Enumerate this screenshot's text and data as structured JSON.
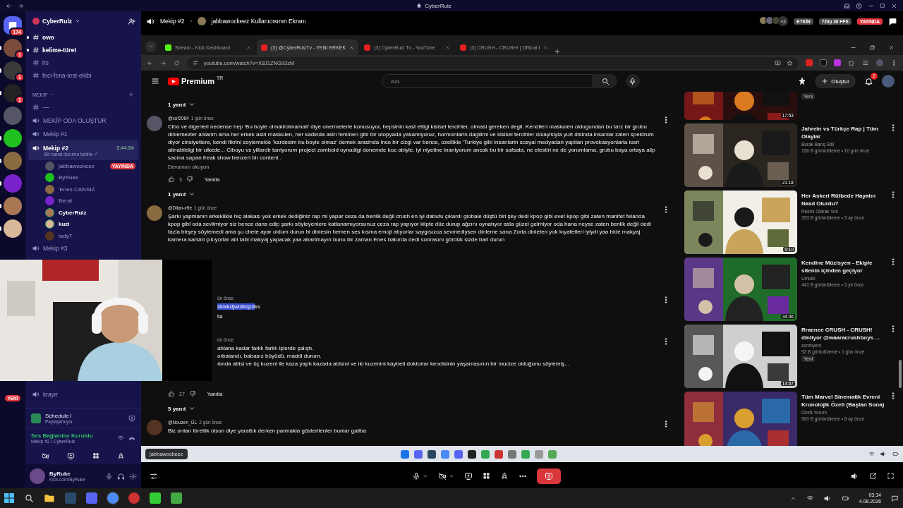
{
  "title_bar": {
    "title": "CyberRulz"
  },
  "server_rail": {
    "home_badge": "174",
    "new_badge": "YENİ",
    "servers": [
      {
        "unread": true,
        "badge": "1"
      },
      {
        "unread": true,
        "badge": "1"
      },
      {
        "unread": true,
        "badge": "1"
      },
      {
        "unread": false
      },
      {
        "unread": true
      },
      {
        "unread": true
      },
      {
        "unread": true
      },
      {
        "unread": true
      },
      {
        "unread": true
      }
    ]
  },
  "sidebar": {
    "server_name": "CyberRulz",
    "category": "MEKİP",
    "channels": [
      {
        "name": "owo",
        "unread": true
      },
      {
        "name": "kelime-türet",
        "unread": true
      },
      {
        "name": "lrs",
        "unread": false
      },
      {
        "name": "feci-fena-test-ekibi",
        "unread": false
      }
    ],
    "items": [
      {
        "kind": "text",
        "name": "—",
        "selected": false
      },
      {
        "kind": "voice",
        "name": "MEKİP ODA OLUŞTUR",
        "selected": false
      },
      {
        "kind": "voice",
        "name": "Mekip #1",
        "selected": false
      },
      {
        "kind": "voice",
        "name": "Mekip #2",
        "selected": true,
        "timer": "3:44:54",
        "status": "Bir kanal durumu belirle",
        "members": [
          {
            "name": "jabbawockeez",
            "speaking": false,
            "live": "YAYINDA"
          },
          {
            "name": "ByRuke",
            "speaking": false
          },
          {
            "name": "'Enes CANSIZ",
            "speaking": false
          },
          {
            "name": "Berat",
            "speaking": false
          },
          {
            "name": "CyberRulz",
            "speaking": true
          },
          {
            "name": "kuzi",
            "speaking": true
          },
          {
            "name": "ladyT",
            "speaking": false
          }
        ]
      },
      {
        "kind": "voice",
        "name": "Mekip #3",
        "selected": false
      }
    ],
    "lower_items": [
      {
        "kind": "voice",
        "name": "krayir",
        "selected": false
      }
    ],
    "activity": {
      "title": "Schedule I",
      "subtitle": "Paylaşılmıyor"
    },
    "voice_panel": {
      "status": "Ses Bağlantısı Kuruldu",
      "location": "Mekip #2 / CyberRulz"
    },
    "user_panel": {
      "name": "ByRuke",
      "status": "Kick.com/ByRuke"
    }
  },
  "stream_header": {
    "channel": "Mekip #2",
    "title": "jabbawockeez Kullanıcısının Ekranı",
    "viewer_extra": "+2",
    "activity_badge": "ETKİN",
    "quality": "720p 30 FPS",
    "live_badge": "YAYINDA"
  },
  "browser": {
    "url": "youtube.com/watch?v=X8J1ZNG93zM",
    "tabs": [
      {
        "title": "Stream - Kick Dashboard",
        "kind": "kick",
        "selected": false
      },
      {
        "title": "(3) @CyberRulzTv - YENİ ERKEK",
        "kind": "youtube",
        "selected": true
      },
      {
        "title": "(3) CyberRulz Tv - YouTube",
        "kind": "youtube",
        "selected": false
      },
      {
        "title": "(3) CRUSH - CRUSH! | Official I",
        "kind": "youtube",
        "selected": false
      }
    ]
  },
  "youtube": {
    "logo": "Premium",
    "region": "TR",
    "search_placeholder": "Ara",
    "create_label": "Oluştur",
    "notification_count": "2",
    "comments": [
      {
        "kind": "replies",
        "label": "1 yanıt"
      },
      {
        "kind": "comment",
        "author": "@xof2064",
        "time": "1 gün önce",
        "text": "Cibo ve digerleri nedense hep 'Bu boyle olmali/olmamali' diye onermelerle konusuyor, hepsinin kast ettigi kisisel tercihler, olmasi gereken degil. Kendileri maskulen oldugundan bu tarz bir grubu dinlemezler anlarim ama her erkek asiri maskulen, her kadinda asiri feminen gibi bir utopyada yasamiyoruz, hormonlarin dagilimi ve kisisel tercihler dolayisiyla yurt disinda insanlar zaten spektrum diyor cinsiyetlere, kendi fikrini soylemekle 'kardesim bu boyle olmaz' demek arasinda ince bir cizgi var bence, ozellikle 'Turkiye gibi insanlarin sosyal medyadan yapilan provokasyonlarla iceri alinabildigi bir ulkede... Ciboyu vs yillardir taniyorum project zomboid oynadigi donemde koc abiyle, iyi niyetine inaniyorum ancak bu bir safsata, ne elestiri ne de yorumlama, grubu baya ortaya alip sacma sapan freak show benzeri bir content .",
        "more": "Devamını okuyun",
        "likes": "3",
        "reply": "Yanıtla"
      },
      {
        "kind": "replies",
        "label": "1 yanıt"
      },
      {
        "kind": "comment",
        "author": "@Dilan-v9e",
        "time": "1 gün önce",
        "text": "Şarkı yapmanın erkeklikle hiç alakası yok erkek dediğiniz rap mi yapar  ceza da benlik değil crush en iyi dabutu çıkardı globale düştü biri şey dedi kpop gibi evet kpop gibi zaten manifet felanda kpop gibi oda sevilmiyor siz bence dans edip şarkı söyleyenlere katlanamıyorsunuz ceza rap yapıyor klipte düz durup ağzını oynatıyor asla güzel gelmiyor oda bana neyse zaten benlik değil dedi fazla birşey söylemedi ama şu chete ayar oldum durun bi dinlesin hemen ses kısma emoji atıyorlar saygısızca sevmediysen dinleme sana Zorla dinleten yok kıyafetleri iyiydi yaa bide makyaj kamera karsini çıkıyorlar abi tabi makyaj yapacak yaa abartmayın bunu bir zaman Enes baturda dedi sonrasını gördük sizde bari durun"
      },
      {
        "kind": "partial",
        "time": "ün önce",
        "parts": [
          {
            "text": "skwkdjwldkspd",
            "highlighted": true
          },
          {
            "text": "ks",
            "highlighted": false
          }
        ],
        "reply_fragment": "tla"
      },
      {
        "kind": "partial",
        "time": "ün önce",
        "lines": [
          "atılana kadar farklı farklı işlerde çalıştı.",
          "orbalandı, babasız büyüdü, maddi durum.",
          "ılında abisi ve üç kuzeni ile kaza yaptı kazada abisini ve iki kuzenini kaybeti doktorlar kendisinin yaşamasının bir mucize olduğunu söylemiş..."
        ],
        "likes": "27",
        "reply": "Yanıtla"
      },
      {
        "kind": "replies",
        "label": "5 yanıt"
      },
      {
        "kind": "comment",
        "author": "@Nouzen_GL",
        "time": "2 gün önce",
        "text": "Biz onları ibretlik olsun diye yarattık derken parmakla gösterilenler bunlar galiba"
      }
    ],
    "recommendations": [
      {
        "kind": "partial",
        "duration": "17:53",
        "badge": "Yeni"
      },
      {
        "kind": "video",
        "title": "Jahrein vs Türkçe Rap | Tüm Olaylar",
        "channel": "Burak Barış Stili",
        "meta": "156 B görüntüleme • 10 gün önce",
        "duration": "21:18"
      },
      {
        "kind": "video",
        "title": "Her Askeri Rütbede Hayatın Nasıl Olurdu?",
        "channel": "Resmi Olarak Yok",
        "meta": "333 B görüntüleme • 3 ay önce",
        "duration": "9:10"
      },
      {
        "kind": "video",
        "title": "Kendine Müzisyen - Ekiple sitenin içinden geçiyor",
        "channel": "Umulix",
        "meta": "441 B görüntüleme • 3 yıl önce",
        "duration": "34:06"
      },
      {
        "kind": "video",
        "title": "Rraenee CRUSH - CRUSH! dinliyor @waaracrushboys ...",
        "channel": "zombyers",
        "meta": "92 B görüntüleme • 1 gün önce",
        "badge": "Yeni",
        "duration": "13:57"
      },
      {
        "kind": "video",
        "title": "Tüm Marvel Sinematik Evreni Kronolojik Özeti (Baştan Sona)",
        "channel": "Özeti-Yorum",
        "meta": "500 B görüntüleme • 5 ay önce"
      }
    ]
  },
  "stream_taskbar": {
    "tooltip": "jabbawockeez"
  },
  "taskbar": {
    "time": "03:14",
    "date": "4.08.2026"
  }
}
